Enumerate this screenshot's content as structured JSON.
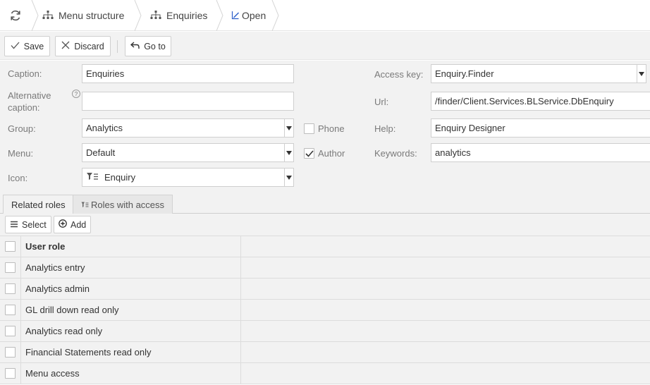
{
  "breadcrumbs": [
    {
      "label": "Menu structure",
      "icon": "sitemap-icon"
    },
    {
      "label": "Enquiries",
      "icon": "sitemap-icon"
    },
    {
      "label": "Open",
      "icon": "open-edit-icon"
    }
  ],
  "toolbar": {
    "save_label": "Save",
    "discard_label": "Discard",
    "goto_label": "Go to"
  },
  "form": {
    "caption": {
      "label": "Caption:",
      "value": "Enquiries"
    },
    "alt_caption": {
      "label_line1": "Alternative",
      "label_line2": "caption:",
      "value": "",
      "help": "?"
    },
    "group": {
      "label": "Group:",
      "value": "Analytics"
    },
    "menu": {
      "label": "Menu:",
      "value": "Default"
    },
    "icon": {
      "label": "Icon:",
      "value": "Enquiry"
    },
    "phone": {
      "label": "Phone",
      "checked": false
    },
    "author": {
      "label": "Author",
      "checked": true
    },
    "access_key": {
      "label": "Access key:",
      "value": "Enquiry.Finder"
    },
    "url": {
      "label": "Url:",
      "value": "/finder/Client.Services.BLService.DbEnquiry"
    },
    "help": {
      "label": "Help:",
      "value": "Enquiry Designer"
    },
    "keywords": {
      "label": "Keywords:",
      "value": "analytics"
    }
  },
  "tabs": [
    {
      "label": "Related roles",
      "active": true
    },
    {
      "label": "Roles with access",
      "active": false
    }
  ],
  "grid_toolbar": {
    "select_label": "Select",
    "add_label": "Add"
  },
  "grid": {
    "header": "User role",
    "rows": [
      "Analytics entry",
      "Analytics admin",
      "GL drill down read only",
      "Analytics read only",
      "Financial Statements read only",
      "Menu access"
    ]
  },
  "colors": {
    "background": "#f2f2f2",
    "accent": "#2d5fc9"
  }
}
